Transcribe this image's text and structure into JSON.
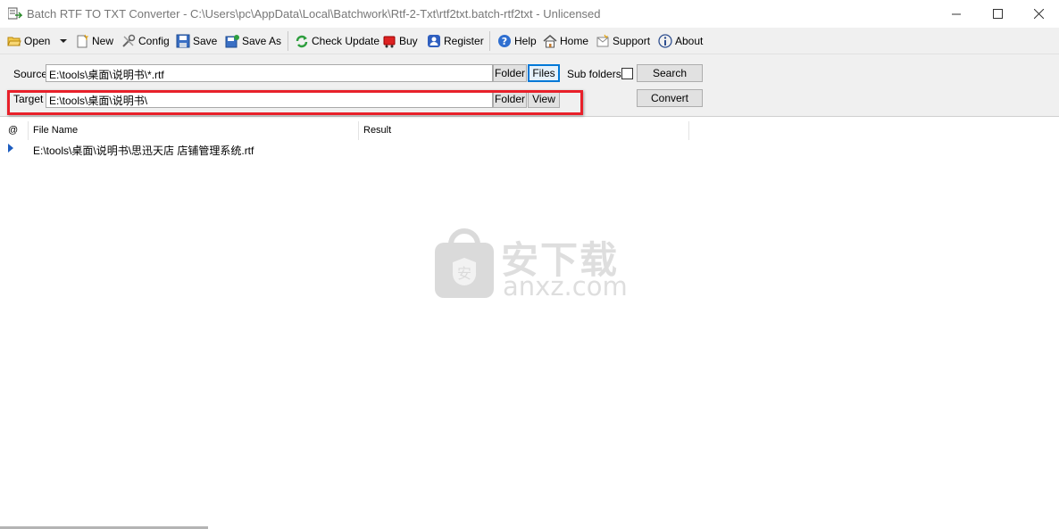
{
  "window": {
    "title": "Batch RTF TO TXT Converter - C:\\Users\\pc\\AppData\\Local\\Batchwork\\Rtf-2-Txt\\rtf2txt.batch-rtf2txt - Unlicensed"
  },
  "toolbar": {
    "open": "Open",
    "new": "New",
    "config": "Config",
    "save": "Save",
    "save_as": "Save As",
    "check_update": "Check Update",
    "buy": "Buy",
    "register": "Register",
    "help": "Help",
    "home": "Home",
    "support": "Support",
    "about": "About"
  },
  "options": {
    "source_label": "Source",
    "source_value": "E:\\tools\\桌面\\说明书\\*.rtf",
    "target_label": "Target",
    "target_value": "E:\\tools\\桌面\\说明书\\",
    "folder_button": "Folder",
    "files_button": "Files",
    "view_button": "View",
    "subfolders_label": "Sub folders",
    "subfolders_checked": false,
    "search_button": "Search",
    "convert_button": "Convert"
  },
  "grid": {
    "columns": [
      "@",
      "File Name",
      "Result"
    ],
    "rows": [
      {
        "file_name": "E:\\tools\\桌面\\说明书\\思迅天店 店铺管理系统.rtf",
        "result": ""
      }
    ]
  },
  "watermark": {
    "cn": "安下载",
    "en": "anxz.com"
  },
  "colors": {
    "highlight": "#e8202a",
    "focus": "#0078d7"
  }
}
